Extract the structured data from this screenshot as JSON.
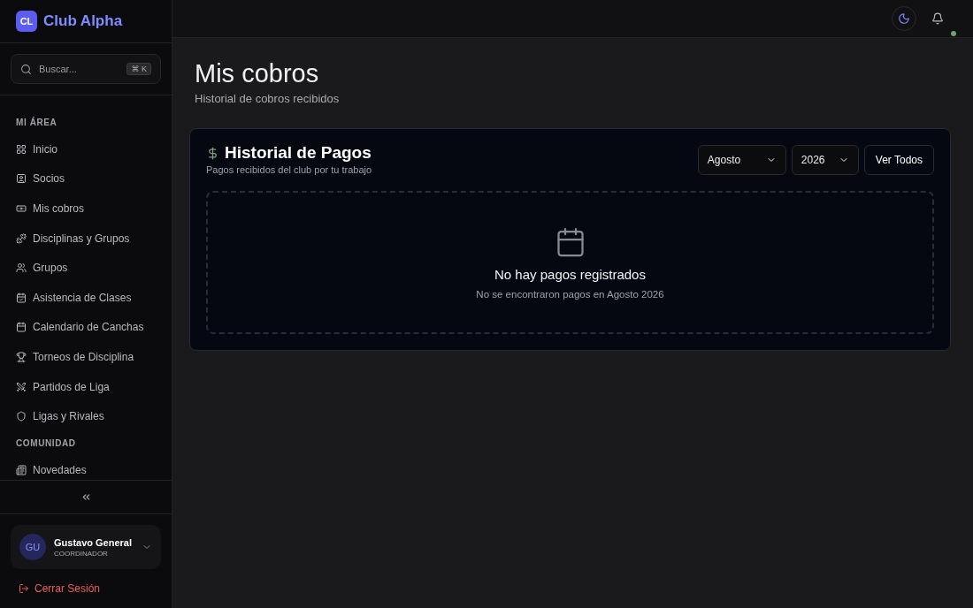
{
  "brand": {
    "badge": "CL",
    "name": "Club Alpha"
  },
  "search": {
    "placeholder": "Buscar...",
    "shortcut": "⌘ K"
  },
  "sidebar": {
    "sections": [
      {
        "title": "MI ÁREA",
        "items": [
          {
            "label": "Inicio",
            "selected": false
          },
          {
            "label": "Socios",
            "selected": false
          },
          {
            "label": "Mis cobros",
            "selected": false
          },
          {
            "label": "Disciplinas y Grupos",
            "selected": false
          },
          {
            "label": "Grupos",
            "selected": false
          },
          {
            "label": "Asistencia de Clases",
            "selected": false
          },
          {
            "label": "Calendario de Canchas",
            "selected": false
          },
          {
            "label": "Torneos de Disciplina",
            "selected": false
          },
          {
            "label": "Partidos de Liga",
            "selected": false
          },
          {
            "label": "Ligas y Rivales",
            "selected": false
          }
        ]
      },
      {
        "title": "COMUNIDAD",
        "items": [
          {
            "label": "Novedades",
            "selected": false
          }
        ]
      }
    ]
  },
  "user": {
    "initials": "GU",
    "name": "Gustavo General",
    "role": "COORDINADOR"
  },
  "logout": "Cerrar Sesión",
  "header": {
    "notification_dot": true
  },
  "page": {
    "title": "Mis cobros",
    "subtitle": "Historial de cobros recibidos"
  },
  "card": {
    "title": "Historial de Pagos",
    "subtitle": "Pagos recibidos del club por tu trabajo",
    "month": "Agosto",
    "year": "2026",
    "button": "Ver Todos",
    "empty_title": "No hay pagos registrados",
    "empty_text": "No se encontraron pagos en Agosto 2026"
  }
}
